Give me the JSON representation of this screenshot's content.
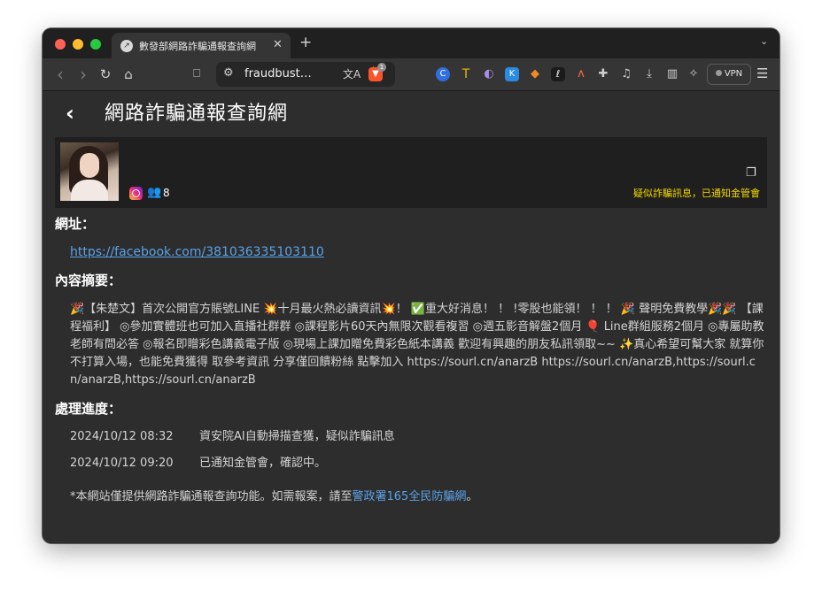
{
  "browser": {
    "tab": {
      "title": "數發部網路詐騙通報查詢網",
      "close": "✕"
    },
    "new_tab": "+",
    "tab_menu": "⌄",
    "toolbar": {
      "back": "‹",
      "forward": "›",
      "reload": "↻",
      "home": "⌂",
      "bookmark": "⎕",
      "url": "fraudbust…",
      "brave_badge": "1",
      "vpn_label": "VPN"
    }
  },
  "page": {
    "title": "網路詐騙通報查詢網",
    "profile": {
      "followers": "8",
      "status": "疑似詐騙訊息，已通知金管會"
    },
    "url_label": "網址：",
    "url": "https://facebook.com/381036335103110",
    "summary_label": "內容摘要：",
    "summary": "🎉【朱楚文】首次公開官方賬號LINE 💥十月最火熱必讀資訊💥！ ✅重大好消息！ ！ !零股也能領！ ！ ！ 🎉 聲明免費教學🎉🎉 【課程福利】 ◎參加實體班也可加入直播社群群 ◎課程影片60天內無限次觀看複習 ◎週五影音解盤2個月 🎈 Line群組服務2個月 ◎專屬助教老師有問必答 ◎報名即贈彩色講義電子版 ◎現場上課加贈免費彩色紙本講義 歡迎有興趣的朋友私訊領取~~ ✨真心希望可幫大家 就算你不打算入場，也能免費獲得 取參考資訊 分享僅回饋粉絲 點擊加入 https://sourl.cn/anarzB https://sourl.cn/anarzB,https://sourl.cn/anarzB,https://sourl.cn/anarzB",
    "progress_label": "處理進度：",
    "progress": [
      {
        "time": "2024/10/12 08:32",
        "text": "資安院AI自動掃描查獲，疑似詐騙訊息"
      },
      {
        "time": "2024/10/12 09:20",
        "text": "已通知金管會，確認中。"
      }
    ],
    "footnote_prefix": "*本網站僅提供網路詐騙通報查詢功能。如需報案，請至",
    "footnote_link": "警政署165全民防騙網",
    "footnote_suffix": "。"
  },
  "colors": {
    "page_bg": "#2d2d2d",
    "card_bg": "#1f1f1f",
    "warning": "#f5d800",
    "link": "#5aa2e8"
  }
}
